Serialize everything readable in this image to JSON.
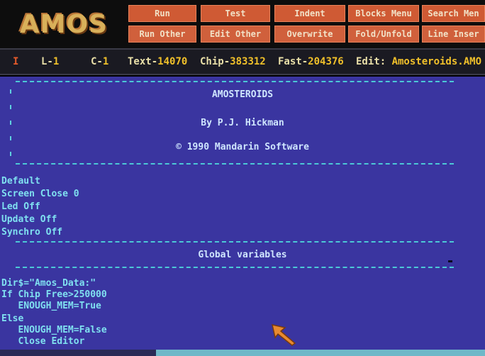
{
  "logo": "AMOS",
  "menu": {
    "row1": [
      "Run",
      "Test",
      "Indent",
      "Blocks Menu",
      "Search Men"
    ],
    "row2": [
      "Run Other",
      "Edit  Other",
      "Overwrite",
      "Fold/Unfold",
      "Line Inser"
    ]
  },
  "status": {
    "insert_flag": "I",
    "line_label": "L-",
    "line_value": "1",
    "col_label": "C-",
    "col_value": "1",
    "text_label": "Text-",
    "text_value": "14070",
    "chip_label": "Chip-",
    "chip_value": "383312",
    "fast_label": "Fast-",
    "fast_value": "204376",
    "edit_label": "Edit: ",
    "edit_value": "Amosteroids.AMO"
  },
  "editor": {
    "title": "AMOSTEROIDS",
    "author": "By P.J. Hickman",
    "copyright": "© 1990 Mandarin Software",
    "setup_lines": [
      "Default",
      "Screen Close 0",
      "Led Off",
      "Update Off",
      "Synchro Off"
    ],
    "section_title": "Global variables",
    "code_lines": [
      "Dir$=\"Amos_Data:\"",
      "If Chip Free>250000",
      "   ENOUGH_MEM=True",
      "Else",
      "   ENOUGH_MEM=False",
      "   Close Editor"
    ]
  },
  "colors": {
    "editor_bg": "#3a35a0",
    "text": "#7fe0f0",
    "menu_button": "#cf5a34",
    "pointer": "#e88a30"
  },
  "icons": {
    "pointer": "mouse-pointer-arrow-icon"
  }
}
